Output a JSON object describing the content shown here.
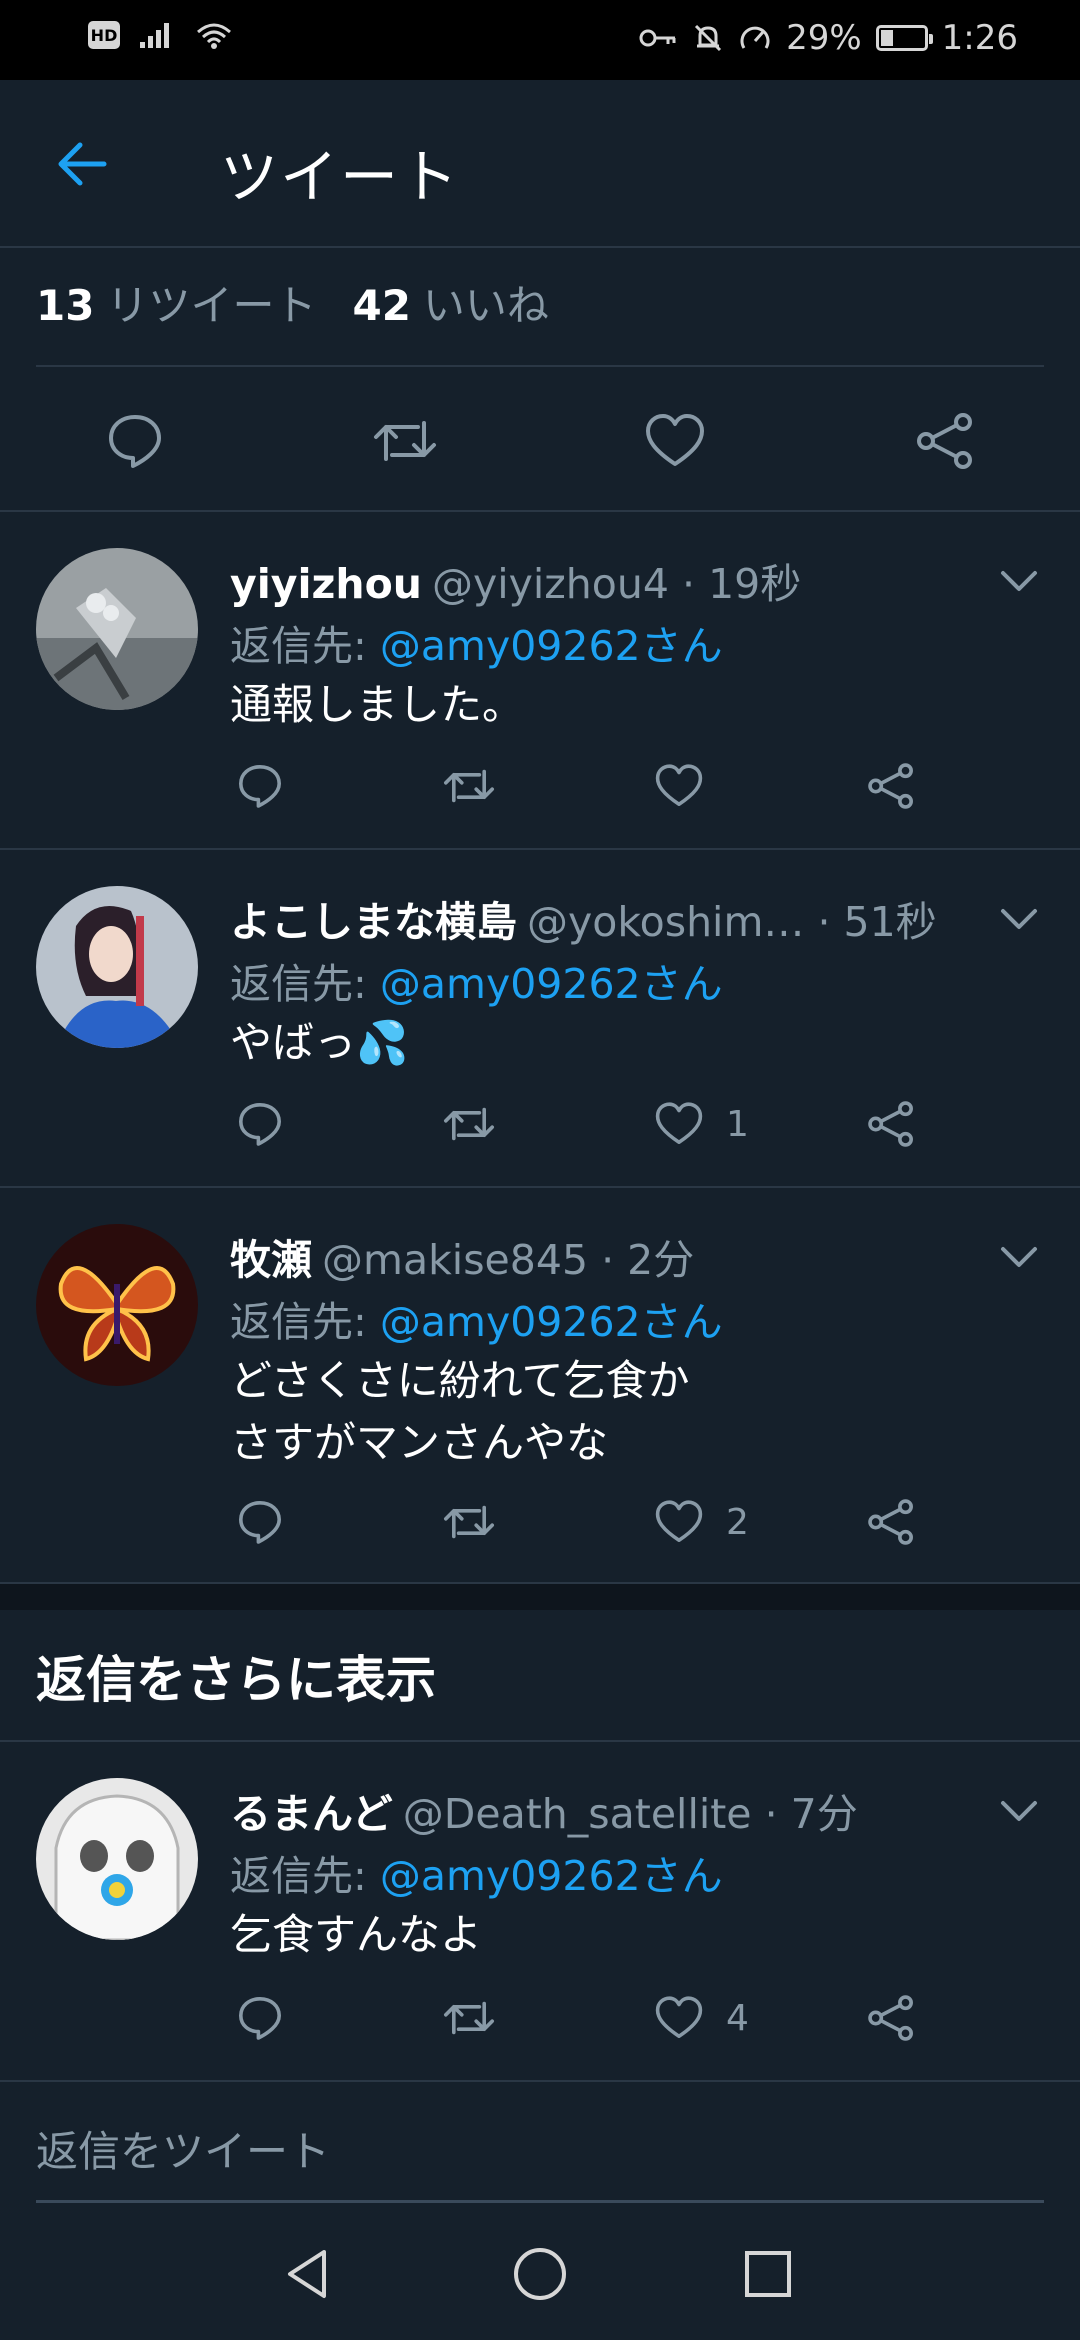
{
  "status_bar": {
    "battery": "29%",
    "time": "1:26",
    "hd": "HD"
  },
  "header": {
    "title": "ツイート"
  },
  "stats": {
    "retweets_count": "13",
    "retweets_label": "リツイート",
    "likes_count": "42",
    "likes_label": "いいね"
  },
  "replies": [
    {
      "name": "yiyizhou",
      "handle": "@yiyizhou4",
      "time": "· 19秒",
      "reply_to_label": "返信先:",
      "reply_to": "@amy09262さん",
      "text": "通報しました。",
      "likes": ""
    },
    {
      "name": "よこしまな横島",
      "handle": "@yokoshim…",
      "time": "· 51秒",
      "reply_to_label": "返信先:",
      "reply_to": "@amy09262さん",
      "text": "やばっ💦",
      "likes": "1"
    },
    {
      "name": "牧瀬",
      "handle": "@makise845",
      "time": "· 2分",
      "reply_to_label": "返信先:",
      "reply_to": "@amy09262さん",
      "text": "どさくさに紛れて乞食か\nさすがマンさんやな",
      "likes": "2"
    },
    {
      "name": "るまんど",
      "handle": "@Death_satellite",
      "time": "· 7分",
      "reply_to_label": "返信先:",
      "reply_to": "@amy09262さん",
      "text": "乞食すんなよ",
      "likes": "4"
    }
  ],
  "more_replies_label": "返信をさらに表示",
  "compose": {
    "placeholder": "返信をツイート"
  },
  "colors": {
    "background": "#15202b",
    "accent": "#1da1f2",
    "muted": "#8899a6",
    "divider": "#2a3745"
  },
  "icons": [
    "back-arrow-icon",
    "reply-icon",
    "retweet-icon",
    "like-icon",
    "share-icon",
    "chevron-down-icon",
    "nav-back-icon",
    "nav-home-icon",
    "nav-recents-icon"
  ]
}
